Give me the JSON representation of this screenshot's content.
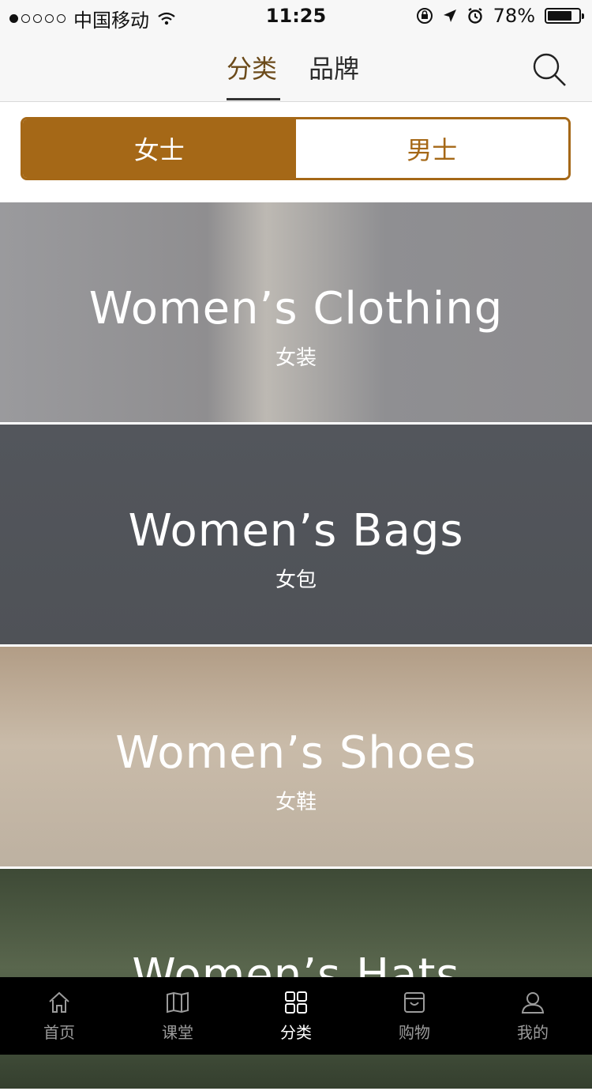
{
  "status_bar": {
    "carrier": "中国移动",
    "time": "11:25",
    "battery": "78%"
  },
  "header": {
    "tabs": [
      {
        "label": "分类",
        "active": true
      },
      {
        "label": "品牌",
        "active": false
      }
    ],
    "search_icon": "search-icon"
  },
  "gender_switch": {
    "options": [
      {
        "label": "女士",
        "active": true
      },
      {
        "label": "男士",
        "active": false
      }
    ],
    "accent_color": "#a56817"
  },
  "categories": [
    {
      "title": "Women’s Clothing",
      "subtitle": "女装"
    },
    {
      "title": "Women’s Bags",
      "subtitle": "女包"
    },
    {
      "title": "Women’s Shoes",
      "subtitle": "女鞋"
    },
    {
      "title": "Women’s Hats",
      "subtitle": ""
    }
  ],
  "tab_bar": [
    {
      "label": "首页",
      "icon": "home-icon",
      "active": false
    },
    {
      "label": "课堂",
      "icon": "book-icon",
      "active": false
    },
    {
      "label": "分类",
      "icon": "grid-icon",
      "active": true
    },
    {
      "label": "购物",
      "icon": "shopping-box-icon",
      "active": false
    },
    {
      "label": "我的",
      "icon": "user-icon",
      "active": false
    }
  ]
}
